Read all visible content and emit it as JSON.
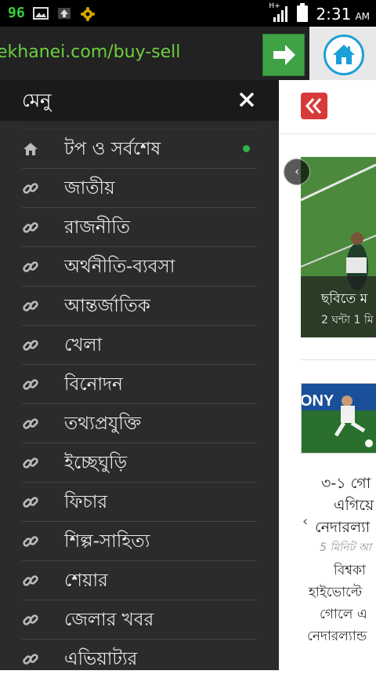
{
  "status_bar": {
    "badge": "96",
    "icons": [
      "image-icon",
      "upload-icon",
      "settings-icon"
    ],
    "network_label": "H+",
    "time": "2:31",
    "ampm": "AM"
  },
  "url_bar": {
    "url": "ekhanei.com/buy-sell"
  },
  "drawer": {
    "title": "মেনু",
    "items": [
      {
        "label": "টপ ও সর্বশেষ",
        "icon": "home-icon",
        "active": true
      },
      {
        "label": "জাতীয়",
        "icon": "link-icon"
      },
      {
        "label": "রাজনীতি",
        "icon": "link-icon"
      },
      {
        "label": "অর্থনীতি-ব্যবসা",
        "icon": "link-icon"
      },
      {
        "label": "আন্তর্জাতিক",
        "icon": "link-icon"
      },
      {
        "label": "খেলা",
        "icon": "link-icon"
      },
      {
        "label": "বিনোদন",
        "icon": "link-icon"
      },
      {
        "label": "তথ্যপ্রযুক্তি",
        "icon": "link-icon"
      },
      {
        "label": "ইচ্ছেঘুড়ি",
        "icon": "link-icon"
      },
      {
        "label": "ফিচার",
        "icon": "link-icon"
      },
      {
        "label": "শিল্প-সাহিত্য",
        "icon": "link-icon"
      },
      {
        "label": "শেয়ার",
        "icon": "link-icon"
      },
      {
        "label": "জেলার খবর",
        "icon": "link-icon"
      },
      {
        "label": "এভিয়াট্যর",
        "icon": "link-icon"
      }
    ]
  },
  "content": {
    "slider": {
      "title": "ছবিতে ম",
      "meta": "2 ঘন্টা 1 মি"
    },
    "article": {
      "headline_lines": [
        "৩-১ গো",
        "এগিয়ে",
        "নেদারল্যা"
      ],
      "ago": "5 মিনিট আ",
      "snippet_lines": [
        "বিশ্বকা",
        "হাইভোল্টে",
        "গোলে এ",
        "নেদারল্যান্ড"
      ]
    }
  },
  "colors": {
    "accent_green": "#3fa346",
    "url_green": "#6ccf3e",
    "home_blue": "#1aa0d8",
    "back_red": "#d83a3a",
    "active_dot": "#2fb34a"
  }
}
